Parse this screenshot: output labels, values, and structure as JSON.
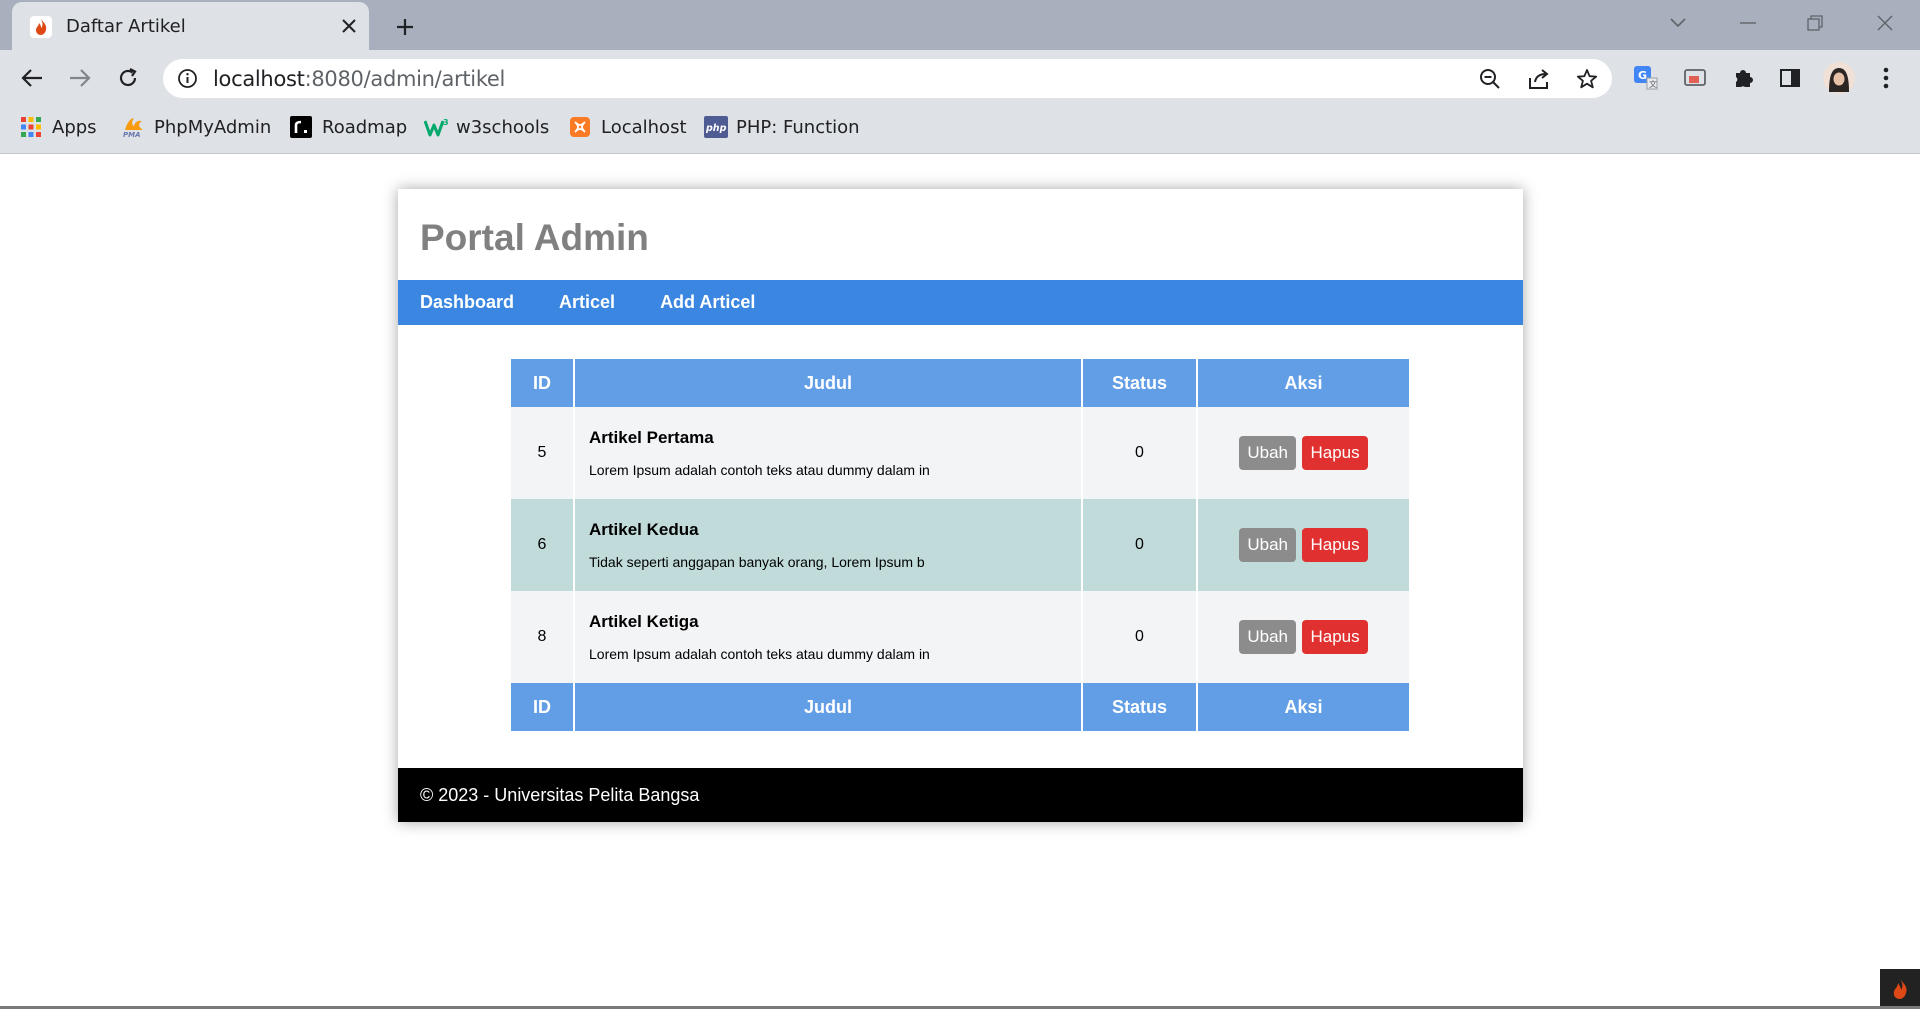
{
  "browser": {
    "tab_title": "Daftar Artikel",
    "url_host": "localhost",
    "url_path": ":8080/admin/artikel",
    "bookmarks": [
      {
        "label": "Apps",
        "icon": "apps-grid-icon"
      },
      {
        "label": "PhpMyAdmin",
        "icon": "phpmyadmin-icon"
      },
      {
        "label": "Roadmap",
        "icon": "roadmap-icon"
      },
      {
        "label": "w3schools",
        "icon": "w3schools-icon"
      },
      {
        "label": "Localhost",
        "icon": "xampp-icon"
      },
      {
        "label": "PHP: Function",
        "icon": "php-icon"
      }
    ]
  },
  "site": {
    "title": "Portal Admin",
    "nav": [
      "Dashboard",
      "Articel",
      "Add Articel"
    ],
    "footer": "© 2023 - Universitas Pelita Bangsa"
  },
  "table": {
    "headers": [
      "ID",
      "Judul",
      "Status",
      "Aksi"
    ],
    "rows": [
      {
        "id": "5",
        "title": "Artikel Pertama",
        "excerpt": "Lorem Ipsum adalah contoh teks atau dummy dalam in",
        "status": "0",
        "edit": "Ubah",
        "delete": "Hapus"
      },
      {
        "id": "6",
        "title": "Artikel Kedua",
        "excerpt": "Tidak seperti anggapan banyak orang, Lorem Ipsum b",
        "status": "0",
        "edit": "Ubah",
        "delete": "Hapus"
      },
      {
        "id": "8",
        "title": "Artikel Ketiga",
        "excerpt": "Lorem Ipsum adalah contoh teks atau dummy dalam in",
        "status": "0",
        "edit": "Ubah",
        "delete": "Hapus"
      }
    ]
  },
  "colors": {
    "nav_bg": "#3a86e0",
    "table_header": "#629ee6",
    "row_alt": "#c1dbdb",
    "btn_edit": "#8c8c8c",
    "btn_delete": "#e0302f"
  }
}
